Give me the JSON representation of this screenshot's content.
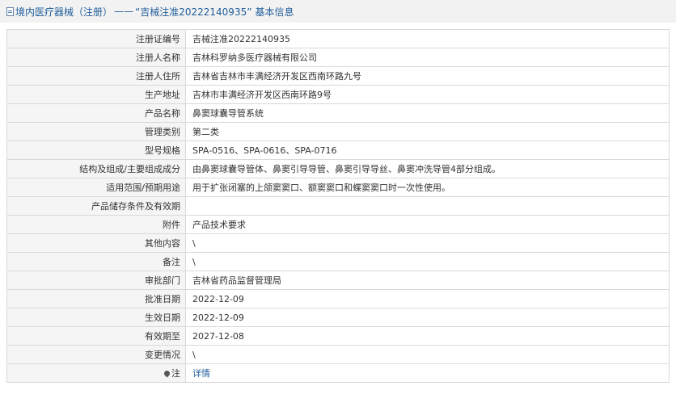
{
  "header": {
    "section": "境内医疗器械（注册）",
    "dash": "——",
    "record_title": "“吉械注准20222140935”",
    "suffix": "基本信息"
  },
  "rows": [
    {
      "label": "注册证编号",
      "value": "吉械注准20222140935"
    },
    {
      "label": "注册人名称",
      "value": "吉林科罗纳多医疗器械有限公司"
    },
    {
      "label": "注册人住所",
      "value": "吉林省吉林市丰满经济开发区西南环路九号"
    },
    {
      "label": "生产地址",
      "value": "吉林市丰满经济开发区西南环路9号"
    },
    {
      "label": "产品名称",
      "value": "鼻窦球囊导管系统"
    },
    {
      "label": "管理类别",
      "value": "第二类"
    },
    {
      "label": "型号规格",
      "value": "SPA-0516、SPA-0616、SPA-0716"
    },
    {
      "label": "结构及组成/主要组成成分",
      "value": "由鼻窦球囊导管体、鼻窦引导导管、鼻窦引导导丝、鼻窦冲洗导管4部分组成。"
    },
    {
      "label": "适用范围/预期用途",
      "value": "用于扩张闭塞的上颌窦窦口、额窦窦口和蝶窦窦口时一次性使用。"
    },
    {
      "label": "产品储存条件及有效期",
      "value": ""
    },
    {
      "label": "附件",
      "value": "产品技术要求"
    },
    {
      "label": "其他内容",
      "value": "\\"
    },
    {
      "label": "备注",
      "value": "\\"
    },
    {
      "label": "审批部门",
      "value": "吉林省药品监督管理局"
    },
    {
      "label": "批准日期",
      "value": "2022-12-09"
    },
    {
      "label": "生效日期",
      "value": "2022-12-09"
    },
    {
      "label": "有效期至",
      "value": "2027-12-08"
    },
    {
      "label": "变更情况",
      "value": "\\"
    }
  ],
  "note_row": {
    "label": "注",
    "link": "详情"
  }
}
